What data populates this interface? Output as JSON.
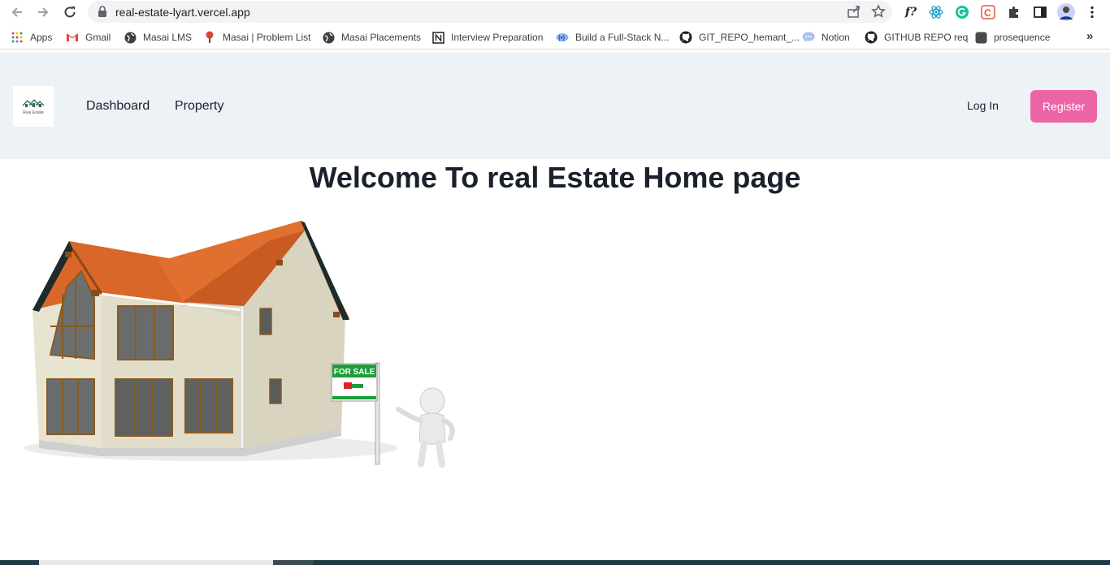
{
  "browser": {
    "url": "real-estate-lyart.vercel.app",
    "bookmarks": [
      {
        "label": "Apps",
        "icon": "apps-grid-icon"
      },
      {
        "label": "Gmail",
        "icon": "gmail-icon"
      },
      {
        "label": "Masai LMS",
        "icon": "globe-icon"
      },
      {
        "label": "Masai | Problem List",
        "icon": "masai-icon"
      },
      {
        "label": "Masai Placements",
        "icon": "globe-icon"
      },
      {
        "label": "Interview Preparation",
        "icon": "notion-icon"
      },
      {
        "label": "Build a Full-Stack N...",
        "icon": "build-icon"
      },
      {
        "label": "GIT_REPO_hemant_...",
        "icon": "github-icon"
      },
      {
        "label": "Notion",
        "icon": "chat-icon"
      },
      {
        "label": "GITHUB REPO req",
        "icon": "github-icon"
      },
      {
        "label": "prosequence",
        "icon": "prosequence-icon"
      }
    ],
    "overflow_label": "»"
  },
  "header": {
    "logo_text": "Real Estate",
    "nav": {
      "dashboard": "Dashboard",
      "property": "Property"
    },
    "login": "Log In",
    "register": "Register",
    "register_color": "#ED64A6"
  },
  "main": {
    "title": "Welcome To real Estate Home page",
    "sign_text": "FOR SALE"
  }
}
